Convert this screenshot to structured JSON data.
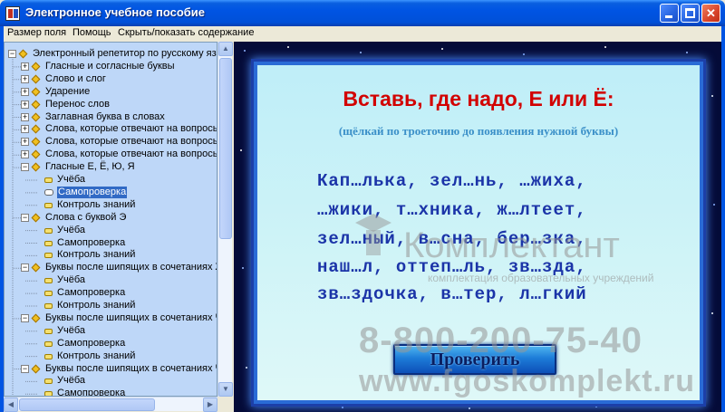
{
  "window": {
    "title": "Электронное учебное пособие",
    "minimize_label": "",
    "maximize_label": "",
    "close_label": "✕"
  },
  "menu": {
    "items": [
      "Размер поля",
      "Помощь",
      "Скрыть/показать содержание"
    ]
  },
  "tree": {
    "items": [
      {
        "label": "Электронный репетитор по русскому языку",
        "level": 0,
        "type": "folder",
        "expander": "−"
      },
      {
        "label": "Гласные и согласные буквы",
        "level": 1,
        "type": "folder",
        "expander": "+"
      },
      {
        "label": "Слово и слог",
        "level": 1,
        "type": "folder",
        "expander": "+"
      },
      {
        "label": "Ударение",
        "level": 1,
        "type": "folder",
        "expander": "+"
      },
      {
        "label": "Перенос слов",
        "level": 1,
        "type": "folder",
        "expander": "+"
      },
      {
        "label": "Заглавная буква в словах",
        "level": 1,
        "type": "folder",
        "expander": "+"
      },
      {
        "label": "Слова, которые отвечают на вопросы КТ",
        "level": 1,
        "type": "folder",
        "expander": "+"
      },
      {
        "label": "Слова, которые отвечают на вопросы КА",
        "level": 1,
        "type": "folder",
        "expander": "+"
      },
      {
        "label": "Слова, которые отвечают на вопросы ЧТ",
        "level": 1,
        "type": "folder",
        "expander": "+"
      },
      {
        "label": "Гласные Е, Ё, Ю, Я",
        "level": 1,
        "type": "folder",
        "expander": "−"
      },
      {
        "label": "Учёба",
        "level": 2,
        "type": "leaf"
      },
      {
        "label": "Самопроверка",
        "level": 2,
        "type": "open",
        "selected": true
      },
      {
        "label": "Контроль знаний",
        "level": 2,
        "type": "leaf"
      },
      {
        "label": "Слова с буквой Э",
        "level": 1,
        "type": "folder",
        "expander": "−"
      },
      {
        "label": "Учёба",
        "level": 2,
        "type": "leaf"
      },
      {
        "label": "Самопроверка",
        "level": 2,
        "type": "leaf"
      },
      {
        "label": "Контроль знаний",
        "level": 2,
        "type": "leaf"
      },
      {
        "label": "Буквы после шипящих в сочетаниях ЖИ,",
        "level": 1,
        "type": "folder",
        "expander": "−"
      },
      {
        "label": "Учёба",
        "level": 2,
        "type": "leaf"
      },
      {
        "label": "Самопроверка",
        "level": 2,
        "type": "leaf"
      },
      {
        "label": "Контроль знаний",
        "level": 2,
        "type": "leaf"
      },
      {
        "label": "Буквы после шипящих в сочетаниях ЧА,",
        "level": 1,
        "type": "folder",
        "expander": "−"
      },
      {
        "label": "Учёба",
        "level": 2,
        "type": "leaf"
      },
      {
        "label": "Самопроверка",
        "level": 2,
        "type": "leaf"
      },
      {
        "label": "Контроль знаний",
        "level": 2,
        "type": "leaf"
      },
      {
        "label": "Буквы после шипящих в сочетаниях ЧУ,",
        "level": 1,
        "type": "folder",
        "expander": "−"
      },
      {
        "label": "Учёба",
        "level": 2,
        "type": "leaf"
      },
      {
        "label": "Самопроверка",
        "level": 2,
        "type": "leaf"
      }
    ]
  },
  "exercise": {
    "title": "Вставь, где надо, Е или Ё:",
    "subtitle": "(щёлкай по троеточию до появления нужной буквы)",
    "lines": [
      "Кап…лька, зел…нь, …жиха,",
      "…жики, т…хника, ж…лтеет,",
      "зел…ный, в…сна, бер…зка,",
      "наш…л, оттеп…ль, зв…зда,",
      "зв…здочка, в…тер, л…гкий"
    ],
    "check_button": "Проверить"
  },
  "watermark": {
    "brand": "Комплектант",
    "tagline": "комплектация образовательных учреждений",
    "phone": "8-800-200-75-40",
    "url": "www.fgoskomplekt.ru"
  },
  "colors": {
    "titlebar": "#0054e3",
    "tree_bg": "#bed7f8",
    "selection": "#316ac5",
    "card_bg": "#cdf3f7",
    "title_red": "#d20000",
    "words_blue": "#1b34a8",
    "space_bg": "#050b38"
  }
}
